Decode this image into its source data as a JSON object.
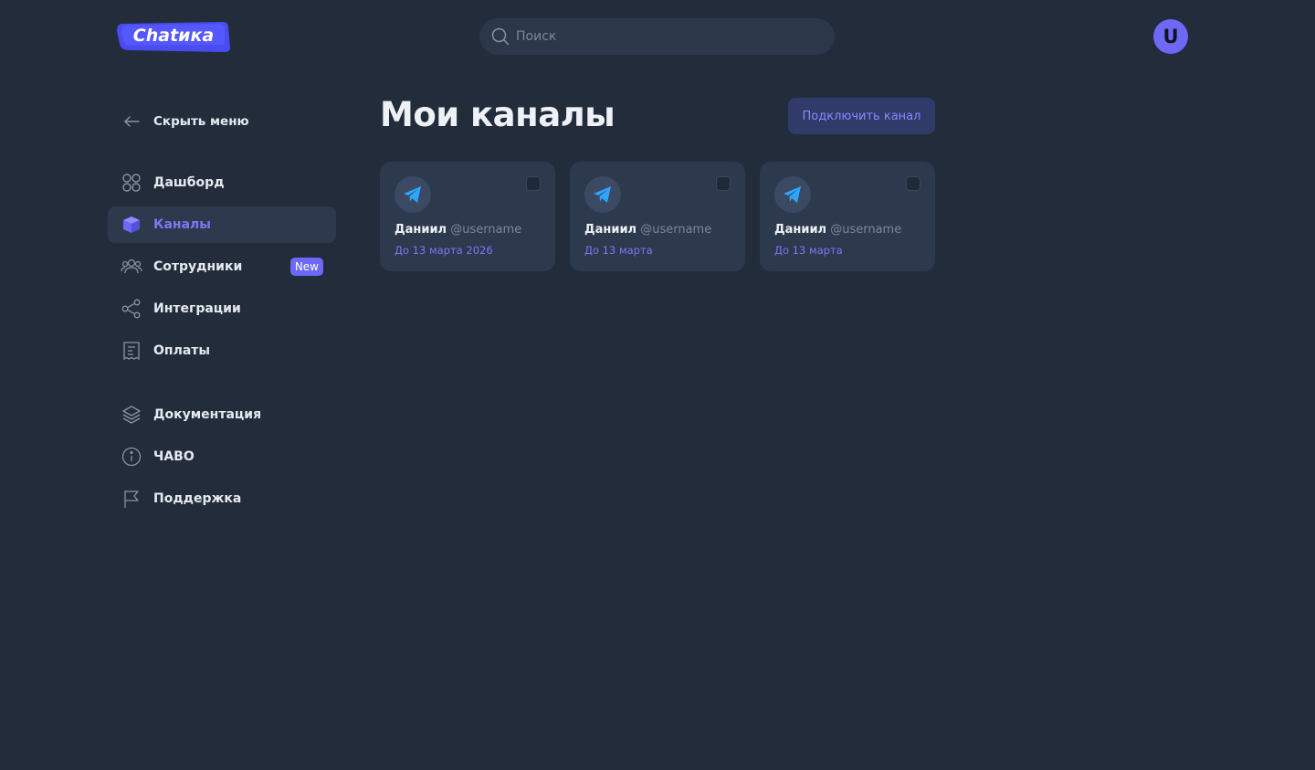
{
  "header": {
    "logo_text": "Chatика",
    "search_placeholder": "Поиск",
    "avatar_letter": "U"
  },
  "sidebar": {
    "hide_menu": "Скрыть меню",
    "items": [
      {
        "label": "Дашборд",
        "icon": "dashboard-icon"
      },
      {
        "label": "Каналы",
        "icon": "channels-icon",
        "active": true
      },
      {
        "label": "Сотрудники",
        "icon": "employees-icon",
        "badge": "New"
      },
      {
        "label": "Интеграции",
        "icon": "share-icon"
      },
      {
        "label": "Оплаты",
        "icon": "receipt-icon"
      }
    ],
    "secondary": [
      {
        "label": "Документация",
        "icon": "layers-icon"
      },
      {
        "label": "ЧАВО",
        "icon": "info-icon"
      },
      {
        "label": "Поддержка",
        "icon": "flag-icon"
      }
    ]
  },
  "main": {
    "title": "Мои каналы",
    "connect_button": "Подключить канал",
    "channels": [
      {
        "name": "Даниил",
        "username": "@username",
        "expires": "До 13 марта 2026"
      },
      {
        "name": "Даниил",
        "username": "@username",
        "expires": "До 13 марта"
      },
      {
        "name": "Даниил",
        "username": "@username",
        "expires": "До 13 марта"
      }
    ]
  },
  "colors": {
    "background": "#222c3b",
    "surface": "#2d394c",
    "accent": "#6d68f5",
    "accent_text": "#7a78f7",
    "telegram_blue": "#2ea6ff"
  }
}
